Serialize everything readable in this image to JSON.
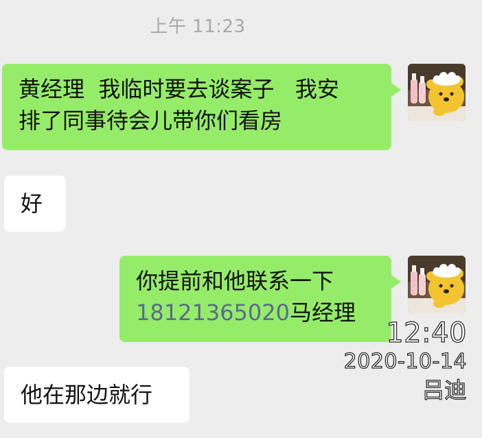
{
  "chat": {
    "timestamp": "上午 11:23",
    "messages": [
      {
        "direction": "outgoing",
        "lines": [
          "黄经理  我临时要去谈案子   我安",
          "排了同事待会儿带你们看房"
        ]
      },
      {
        "direction": "incoming",
        "text": "好"
      },
      {
        "direction": "outgoing",
        "line1": "你提前和他联系一下",
        "phone": "18121365020",
        "line2_suffix": "马经理"
      },
      {
        "direction": "incoming",
        "text": "他在那边就行"
      }
    ],
    "self_avatar": "winnie-the-pooh-avatar"
  },
  "watermark": {
    "time": "12:40",
    "date": "2020-10-14",
    "name": "吕迪"
  },
  "colors": {
    "background": "#ededed",
    "outgoing_bubble": "#95ec69",
    "incoming_bubble": "#ffffff",
    "phone_link": "#5b6a8c",
    "timestamp_text": "#a8a8a8"
  }
}
